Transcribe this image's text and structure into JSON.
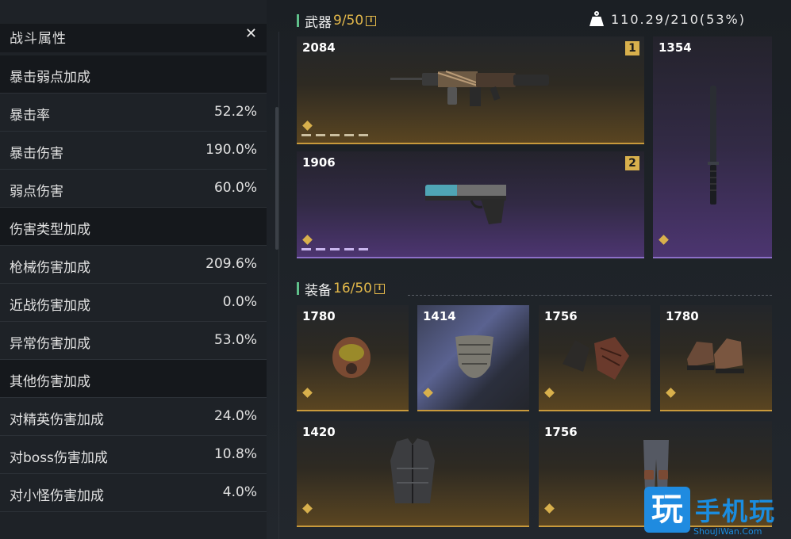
{
  "stats_panel": {
    "title": "战斗属性",
    "close_icon": "close-icon",
    "rows": [
      {
        "type": "section",
        "label": "暴击弱点加成",
        "value": ""
      },
      {
        "type": "stat",
        "label": "暴击率",
        "value": "52.2%"
      },
      {
        "type": "stat",
        "label": "暴击伤害",
        "value": "190.0%"
      },
      {
        "type": "stat",
        "label": "弱点伤害",
        "value": "60.0%"
      },
      {
        "type": "section",
        "label": "伤害类型加成",
        "value": ""
      },
      {
        "type": "stat",
        "label": "枪械伤害加成",
        "value": "209.6%"
      },
      {
        "type": "stat",
        "label": "近战伤害加成",
        "value": "0.0%"
      },
      {
        "type": "stat",
        "label": "异常伤害加成",
        "value": "53.0%"
      },
      {
        "type": "section",
        "label": "其他伤害加成",
        "value": ""
      },
      {
        "type": "stat",
        "label": "对精英伤害加成",
        "value": "24.0%"
      },
      {
        "type": "stat",
        "label": "对boss伤害加成",
        "value": "10.8%"
      },
      {
        "type": "stat",
        "label": "对小怪伤害加成",
        "value": "4.0%"
      }
    ]
  },
  "weight": {
    "icon": "weight-icon",
    "text": "110.29/210(53%)"
  },
  "weapons": {
    "title": "武器",
    "count": "9/50",
    "info_icon": "i",
    "items": [
      {
        "power": "1354",
        "slot": "",
        "rarity": "purple",
        "icon": "baton-icon"
      },
      {
        "power": "2084",
        "slot": "1",
        "rarity": "gold",
        "icon": "machine-gun-icon"
      },
      {
        "power": "1906",
        "slot": "2",
        "rarity": "purple",
        "icon": "pistol-icon"
      }
    ]
  },
  "gear": {
    "title": "装备",
    "count": "16/50",
    "info_icon": "i",
    "items": [
      {
        "power": "1780",
        "icon": "helmet-icon"
      },
      {
        "power": "1414",
        "icon": "mask-icon"
      },
      {
        "power": "1756",
        "icon": "gloves-icon"
      },
      {
        "power": "1780",
        "icon": "boots-icon"
      },
      {
        "power": "1420",
        "icon": "jacket-icon"
      },
      {
        "power": "1756",
        "icon": "pants-icon"
      }
    ]
  },
  "watermark": {
    "logo": "玩",
    "text": "手机玩",
    "sub": "ShouJiWan.Com"
  }
}
